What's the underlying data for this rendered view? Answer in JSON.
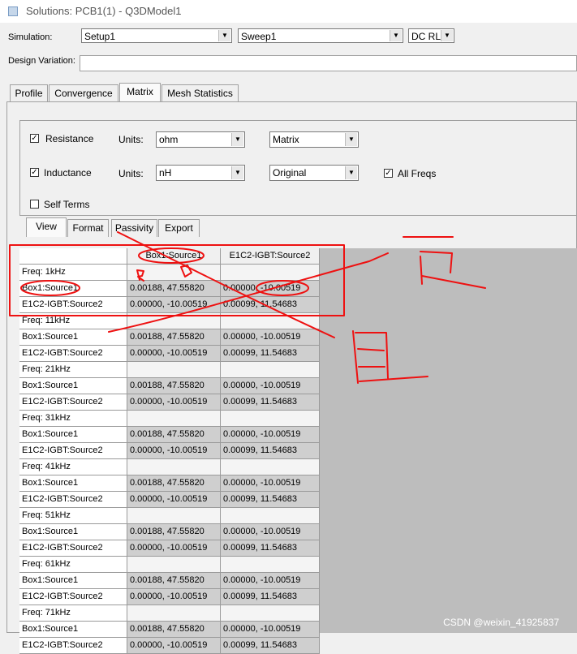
{
  "window": {
    "title": "Solutions: PCB1(1) - Q3DModel1"
  },
  "simulation": {
    "label": "Simulation:",
    "setup": "Setup1",
    "sweep": "Sweep1",
    "mode": "DC RL"
  },
  "design_variation": {
    "label": "Design Variation:",
    "value": ""
  },
  "tabs": [
    {
      "label": "Profile"
    },
    {
      "label": "Convergence"
    },
    {
      "label": "Matrix"
    },
    {
      "label": "Mesh Statistics"
    }
  ],
  "matrix_options": {
    "resistance": {
      "label": "Resistance",
      "checked": true,
      "units_label": "Units:",
      "units": "ohm",
      "display": "Matrix"
    },
    "inductance": {
      "label": "Inductance",
      "checked": true,
      "units_label": "Units:",
      "units": "nH",
      "display": "Original"
    },
    "all_freqs": {
      "label": "All Freqs",
      "checked": true
    },
    "self_terms": {
      "label": "Self Terms",
      "checked": false
    }
  },
  "subtabs": [
    {
      "label": "View"
    },
    {
      "label": "Format"
    },
    {
      "label": "Passivity"
    },
    {
      "label": "Export"
    }
  ],
  "table": {
    "columns": [
      "Box1:Source1",
      "E1C2-IGBT:Source2"
    ],
    "freqs": [
      "Freq: 1kHz",
      "Freq: 11kHz",
      "Freq: 21kHz",
      "Freq: 31kHz",
      "Freq: 41kHz",
      "Freq: 51kHz",
      "Freq: 61kHz",
      "Freq: 71kHz"
    ],
    "rows": [
      {
        "name": "Box1:Source1",
        "values": [
          "0.00188, 47.55820",
          "0.00000, -10.00519"
        ]
      },
      {
        "name": "E1C2-IGBT:Source2",
        "values": [
          "0.00000, -10.00519",
          "0.00099, 11.54683"
        ]
      }
    ]
  },
  "watermark": "CSDN @weixin_41925837",
  "annotation_color": "#ee1111"
}
